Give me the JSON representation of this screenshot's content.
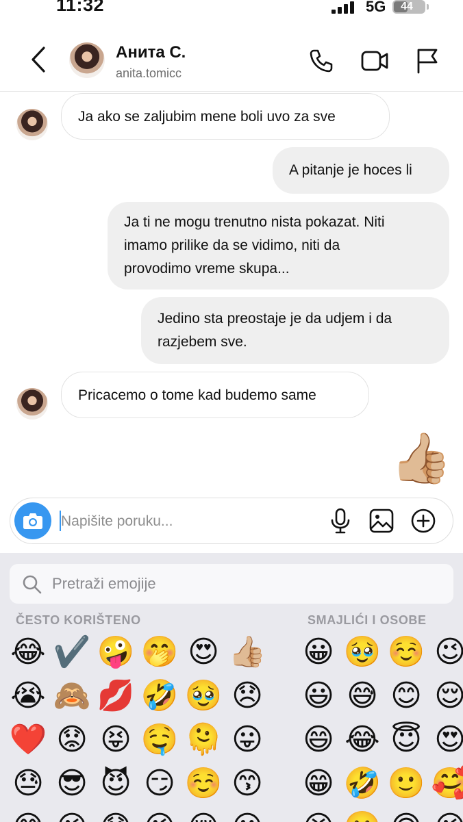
{
  "status_bar": {
    "time": "11:32",
    "network": "5G",
    "battery": "44"
  },
  "header": {
    "name": "Анита С.",
    "handle": "anita.tomicc"
  },
  "messages": [
    {
      "direction": "incoming",
      "lines": [
        "Ja ako se zaljubim mene boli uvo za sve"
      ]
    },
    {
      "direction": "outgoing",
      "lines": [
        "A pitanje je hoces li"
      ]
    },
    {
      "direction": "outgoing",
      "lines": [
        "Ja ti ne mogu trenutno nista pokazat. Niti",
        "imamo prilike da se vidimo, niti da",
        "provodimo vreme skupa..."
      ]
    },
    {
      "direction": "outgoing",
      "lines": [
        "Jedino sta preostaje je da udjem i da",
        "razjebem sve."
      ]
    },
    {
      "direction": "incoming",
      "lines": [
        "Pricacemo o tome kad budemo same"
      ]
    }
  ],
  "reaction": "👍🏼",
  "composer": {
    "placeholder": "Napišite poruku..."
  },
  "emoji_keyboard": {
    "search_placeholder": "Pretraži emojije",
    "sections": [
      "ČESTO KORIŠTENO",
      "SMAJLIĆI I OSOBE"
    ],
    "frequent_rows": [
      [
        "😂",
        "✔️",
        "🤪",
        "🤭",
        "😍",
        "👍🏼"
      ],
      [
        "😭",
        "🙈",
        "💋",
        "🤣",
        "🥹",
        "😞"
      ],
      [
        "❤️",
        "😟",
        "😝",
        "🤤",
        "🫠",
        "😛"
      ],
      [
        "😓",
        "😎",
        "😈",
        "😏",
        "☺️",
        "😙"
      ],
      [
        "😅",
        "😉",
        "😱",
        "😜",
        "😌",
        "😃"
      ]
    ],
    "smileys_rows": [
      [
        "😀",
        "🥹",
        "☺️",
        "😉"
      ],
      [
        "😃",
        "😅",
        "😊",
        "😌"
      ],
      [
        "😄",
        "😂",
        "😇",
        "😍"
      ],
      [
        "😁",
        "🤣",
        "🙂",
        "🥰"
      ],
      [
        "😆",
        "🥲",
        "🙃",
        "😘"
      ]
    ]
  }
}
